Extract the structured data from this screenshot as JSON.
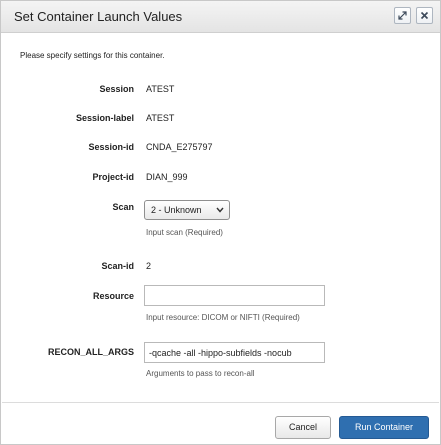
{
  "dialog": {
    "title": "Set Container Launch Values",
    "maximize_icon": "expand-icon",
    "close_icon": "close-icon",
    "intro": "Please specify settings for this container."
  },
  "fields": {
    "session": {
      "label": "Session",
      "value": "ATEST"
    },
    "session_label": {
      "label": "Session-label",
      "value": "ATEST"
    },
    "session_id": {
      "label": "Session-id",
      "value": "CNDA_E275797"
    },
    "project_id": {
      "label": "Project-id",
      "value": "DIAN_999"
    },
    "scan": {
      "label": "Scan",
      "selected": "2 - Unknown",
      "help": "Input scan (Required)"
    },
    "scan_id": {
      "label": "Scan-id",
      "value": "2"
    },
    "resource": {
      "label": "Resource",
      "value": "",
      "help": "Input resource: DICOM or NIFTI (Required)"
    },
    "recon_all_args": {
      "label": "RECON_ALL_ARGS",
      "value": "-qcache -all -hippo-subfields -nocub",
      "help": "Arguments to pass to recon-all"
    }
  },
  "footer": {
    "cancel_label": "Cancel",
    "run_label": "Run Container"
  },
  "colors": {
    "primary_button": "#2f6fb0",
    "titlebar": "#e8e8e8"
  }
}
